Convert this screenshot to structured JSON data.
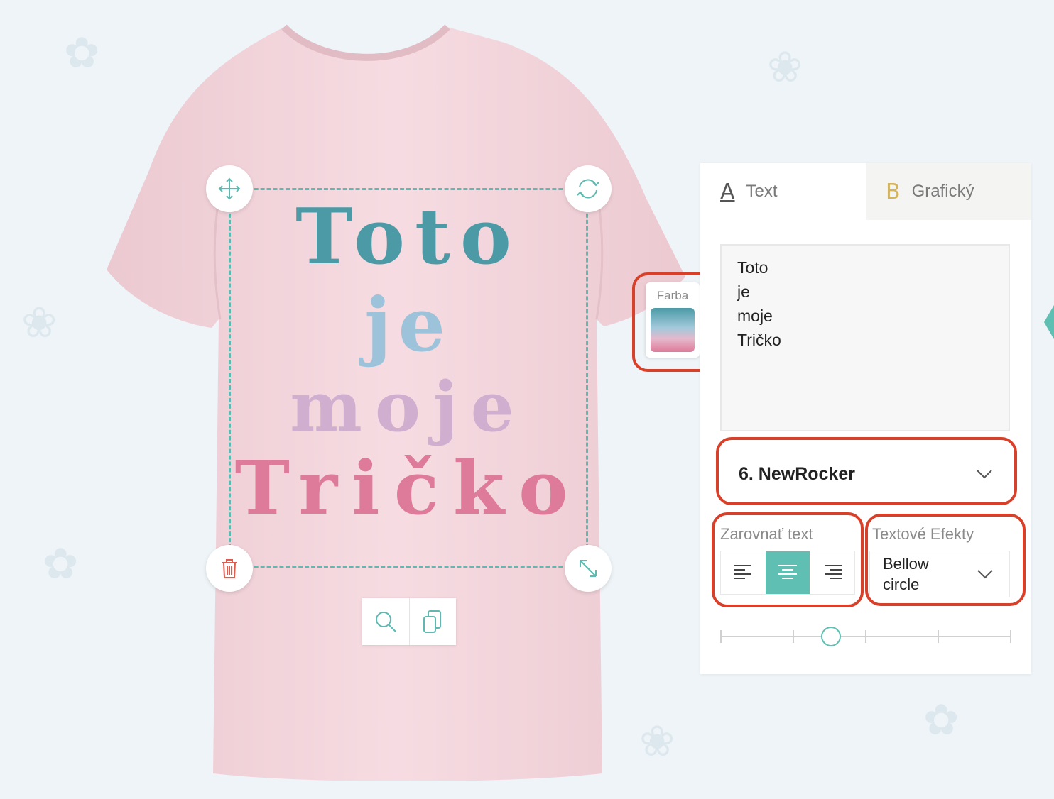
{
  "printed_text": {
    "line1": "Toto",
    "line2": "je",
    "line3": "moje",
    "line4": "Tričko"
  },
  "color_widget": {
    "label": "Farba",
    "gradient_colors": [
      "#4b9aa5",
      "#a2c9dc",
      "#e5b8cb",
      "#de7a9a"
    ]
  },
  "tabs": [
    {
      "label": "Text",
      "icon": "text-a-icon",
      "active": true
    },
    {
      "label": "Grafický",
      "icon": "graphic-b-icon",
      "active": false
    }
  ],
  "text_input": {
    "value": "Toto\nje\nmoje\nTričko"
  },
  "font_select": {
    "value": "6. NewRocker"
  },
  "align": {
    "label": "Zarovnať text",
    "options": [
      "left",
      "center",
      "right"
    ],
    "selected": "center"
  },
  "effects": {
    "label": "Textové Efekty",
    "value": "Bellow circle"
  },
  "slider": {
    "value_fraction": 0.38
  },
  "colors": {
    "accent": "#5fbfb3",
    "highlight_ring": "#d9402a",
    "shirt": "#f5d9df"
  }
}
